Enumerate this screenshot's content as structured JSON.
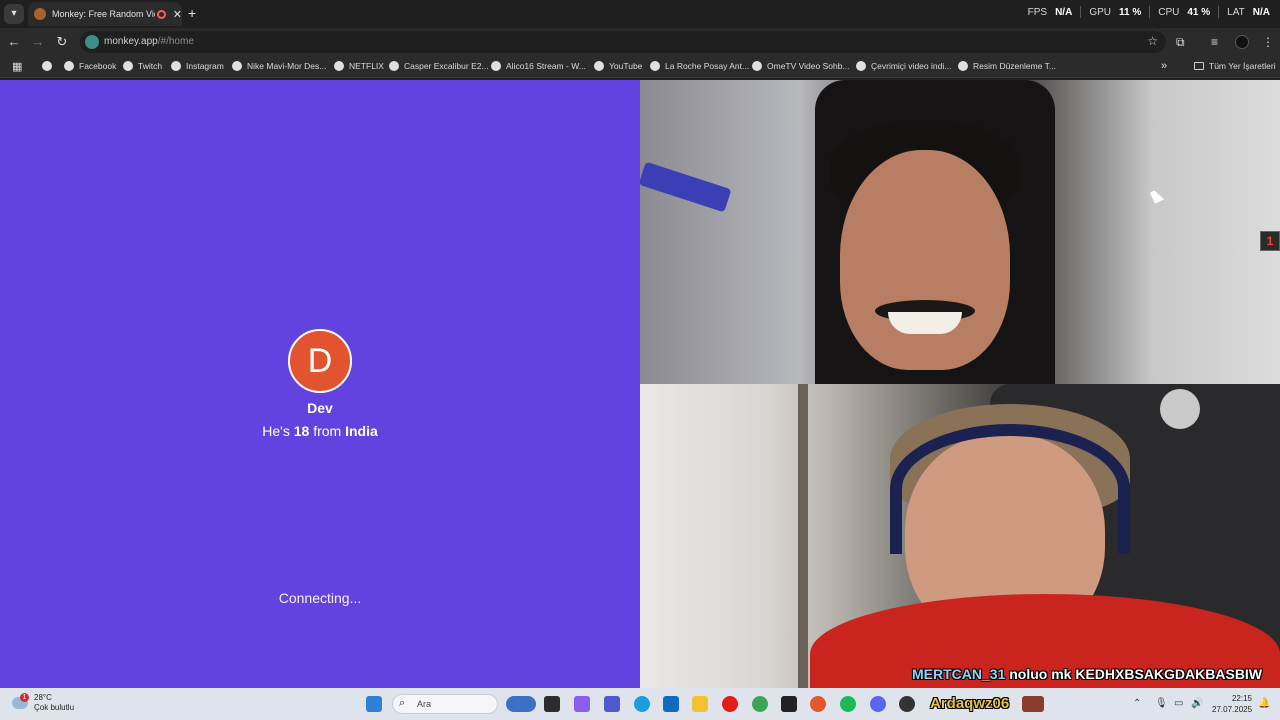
{
  "browser": {
    "tab_title": "Monkey: Free Random Vide",
    "new_tab_symbol": "+",
    "url_host": "monkey.app",
    "url_path": "/#/home"
  },
  "perf_overlay": {
    "fps_label": "FPS",
    "fps_value": "N/A",
    "gpu_label": "GPU",
    "gpu_value": "11 %",
    "cpu_label": "CPU",
    "cpu_value": "41 %",
    "lat_label": "LAT",
    "lat_value": "N/A"
  },
  "bookmarks": [
    {
      "label": ""
    },
    {
      "label": "Facebook"
    },
    {
      "label": "Twitch"
    },
    {
      "label": "Instagram"
    },
    {
      "label": "Nike Mavi-Mor Des..."
    },
    {
      "label": "NETFLIX"
    },
    {
      "label": "Casper Excalibur E2..."
    },
    {
      "label": "Alico16 Stream - W..."
    },
    {
      "label": "YouTube"
    },
    {
      "label": "La Roche Posay Ant..."
    },
    {
      "label": "OmeTV Video Sohb..."
    },
    {
      "label": "Çevrimiçi video indi..."
    },
    {
      "label": "Resim Düzenleme T..."
    }
  ],
  "bookmarks_all": "Tüm Yer İşaretleri",
  "match": {
    "initial": "D",
    "name": "Dev",
    "info_prefix": "He's",
    "age": "18",
    "info_mid": "from",
    "country": "India",
    "status": "Connecting..."
  },
  "stream": {
    "badge": "1",
    "chat_user": "MERTCAN_31",
    "chat_message": "noluo mk KEDHXBSAKGDAKBASBIW",
    "streamer_tag": "Ardaqwz06"
  },
  "taskbar": {
    "weather_temp": "28°C",
    "weather_desc": "Çok bulutlu",
    "weather_badge": "1",
    "search_label": "Ara",
    "time": "22:15",
    "date": "27.07.2025"
  },
  "colors": {
    "accent_purple": "#6343df",
    "avatar_orange": "#e2532f"
  }
}
